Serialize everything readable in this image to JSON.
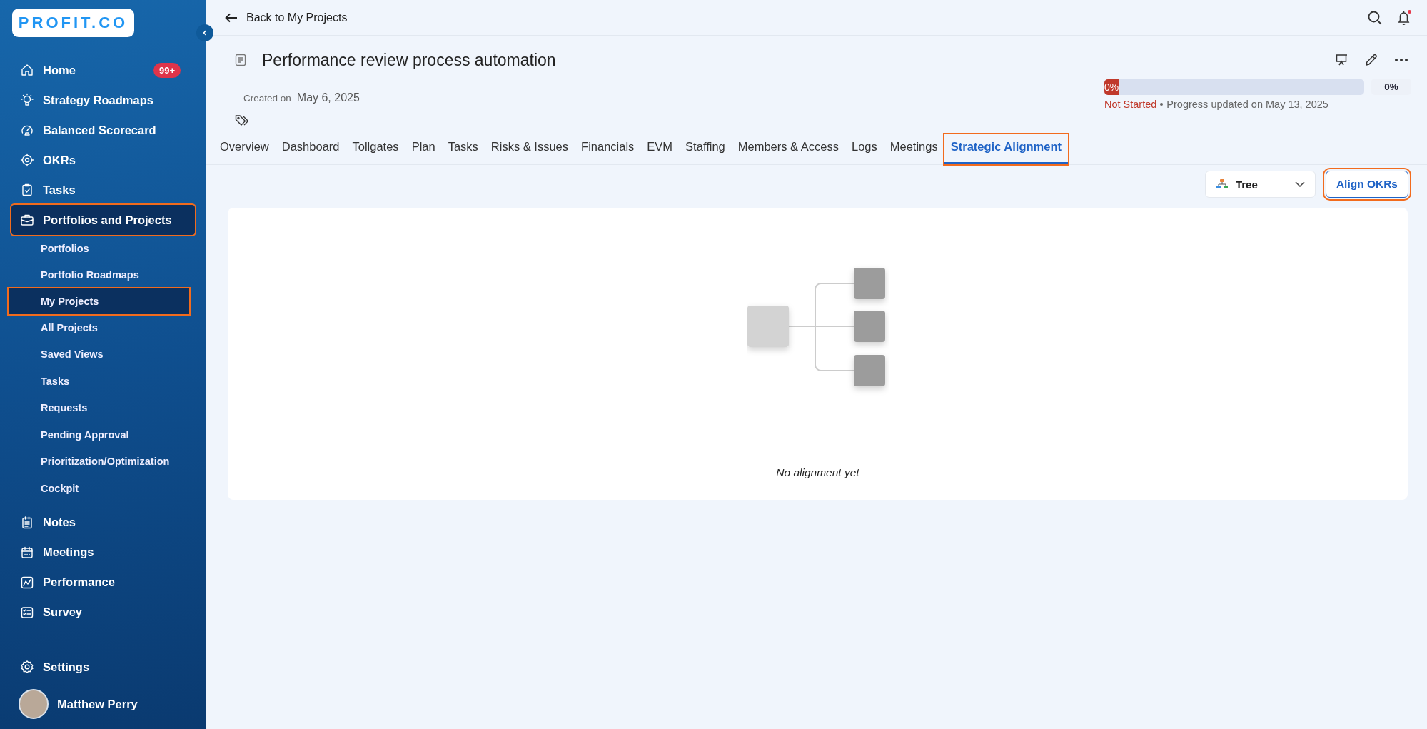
{
  "logo": {
    "text": "PROFIT.CO"
  },
  "sidebar": {
    "items": [
      {
        "label": "Home",
        "badge": "99+",
        "selected": false,
        "highlighted": false
      },
      {
        "label": "Strategy Roadmaps",
        "selected": false,
        "highlighted": false
      },
      {
        "label": "Balanced Scorecard",
        "selected": false,
        "highlighted": false
      },
      {
        "label": "OKRs",
        "selected": false,
        "highlighted": false
      },
      {
        "label": "Tasks",
        "selected": false,
        "highlighted": false
      },
      {
        "label": "Portfolios and Projects",
        "selected": true,
        "highlighted": true,
        "expanded": true,
        "children": [
          {
            "label": "Portfolios",
            "selected": false,
            "highlighted": false
          },
          {
            "label": "Portfolio Roadmaps",
            "selected": false,
            "highlighted": false
          },
          {
            "label": "My Projects",
            "selected": true,
            "highlighted": true
          },
          {
            "label": "All Projects",
            "selected": false,
            "highlighted": false
          },
          {
            "label": "Saved Views",
            "selected": false,
            "highlighted": false
          },
          {
            "label": "Tasks",
            "selected": false,
            "highlighted": false
          },
          {
            "label": "Requests",
            "selected": false,
            "highlighted": false
          },
          {
            "label": "Pending Approval",
            "selected": false,
            "highlighted": false
          },
          {
            "label": "Prioritization/Optimization",
            "selected": false,
            "highlighted": false
          },
          {
            "label": "Cockpit",
            "selected": false,
            "highlighted": false
          }
        ]
      },
      {
        "label": "Notes",
        "selected": false,
        "highlighted": false
      },
      {
        "label": "Meetings",
        "selected": false,
        "highlighted": false
      },
      {
        "label": "Performance",
        "selected": false,
        "highlighted": false
      },
      {
        "label": "Survey",
        "selected": false,
        "highlighted": false
      }
    ],
    "settings": "Settings",
    "user": "Matthew Perry"
  },
  "topbar": {
    "back": "Back to My Projects",
    "notifications_unread": true
  },
  "project": {
    "title": "Performance review process automation",
    "created_label": "Created on",
    "created_date": "May 6, 2025",
    "progress": {
      "level": 0,
      "bar_label": "0%",
      "percent": "0%",
      "status": "Not Started",
      "updated": "Progress updated on May 13, 2025"
    }
  },
  "tabs": [
    {
      "label": "Overview",
      "selected": false,
      "highlighted": false
    },
    {
      "label": "Dashboard",
      "selected": false,
      "highlighted": false
    },
    {
      "label": "Tollgates",
      "selected": false,
      "highlighted": false
    },
    {
      "label": "Plan",
      "selected": false,
      "highlighted": false
    },
    {
      "label": "Tasks",
      "selected": false,
      "highlighted": false
    },
    {
      "label": "Risks & Issues",
      "selected": false,
      "highlighted": false
    },
    {
      "label": "Financials",
      "selected": false,
      "highlighted": false
    },
    {
      "label": "EVM",
      "selected": false,
      "highlighted": false
    },
    {
      "label": "Staffing",
      "selected": false,
      "highlighted": false
    },
    {
      "label": "Members & Access",
      "selected": false,
      "highlighted": false
    },
    {
      "label": "Logs",
      "selected": false,
      "highlighted": false
    },
    {
      "label": "Meetings",
      "selected": false,
      "highlighted": false
    },
    {
      "label": "Strategic Alignment",
      "selected": true,
      "highlighted": true
    }
  ],
  "toolbar": {
    "view_select": {
      "value": "Tree"
    },
    "align_button": {
      "label": "Align OKRs",
      "highlighted": true
    }
  },
  "empty_state": {
    "message": "No alignment yet"
  }
}
